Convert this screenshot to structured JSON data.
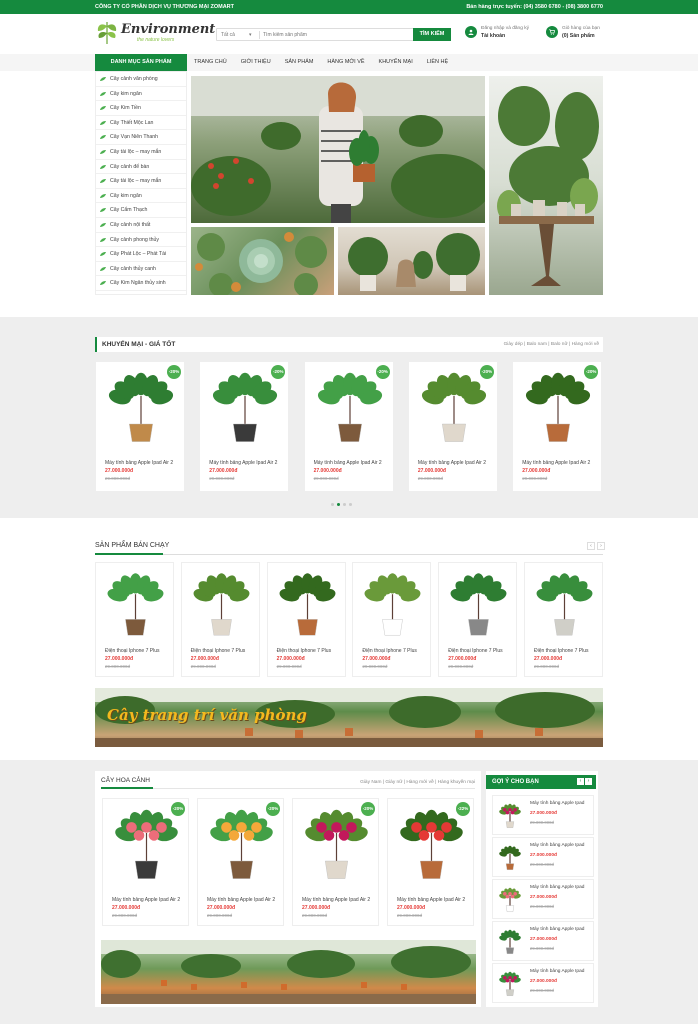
{
  "topbar": {
    "company": "CÔNG TY CỔ PHẦN DỊCH VỤ THƯƠNG MẠI ZOMART",
    "hotline": "Bán hàng trực tuyến: (04) 3580 6780 - (08) 3800 6770"
  },
  "header": {
    "logo_text": "Environment",
    "logo_tagline": "the nature lovers",
    "search_category": "Tất cả",
    "search_placeholder": "Tìm kiếm sản phẩm",
    "search_button": "TÌM KIẾM",
    "account_line1": "Đăng nhập và đăng ký",
    "account_line2": "Tài khoản",
    "cart_line1": "Giỏ hàng của bạn",
    "cart_line2": "(0) Sản phẩm"
  },
  "nav": {
    "category_heading": "DANH MỤC SẢN PHẨM",
    "menu": [
      "TRANG CHỦ",
      "GIỚI THIỆU",
      "SẢN PHẨM",
      "HÀNG MỚI VỀ",
      "KHUYẾN MẠI",
      "LIÊN HỆ"
    ]
  },
  "sidebar": {
    "items": [
      "Cây cảnh văn phòng",
      "Cây kim ngân",
      "Cây Kim Tiền",
      "Cây Thiết Mộc Lan",
      "Cây Vạn Niên Thanh",
      "Cây tài lộc – may mắn",
      "Cây cảnh để bàn",
      "Cây tài lộc – may mắn",
      "Cây kim ngân",
      "Cây Cẩm Thạch",
      "Cây cảnh nội thất",
      "Cây cảnh phong thủy",
      "Cây Phát Lộc – Phát Tài",
      "Cây cảnh thủy canh",
      "Cây Kim Ngân thủy sinh"
    ]
  },
  "promo": {
    "title": "KHUYẾN MẠI - GIÁ TỐT",
    "links": "Giày dép  |  Balo nam  |  Balo nữ  |  Hàng mới về",
    "products": [
      {
        "name": "Máy tính bảng Apple Ipad Air 2",
        "price": "27.000.000đ",
        "old": "29.000.000đ",
        "badge": "-20%"
      },
      {
        "name": "Máy tính bảng Apple Ipad Air 2",
        "price": "27.000.000đ",
        "old": "29.000.000đ",
        "badge": "-20%"
      },
      {
        "name": "Máy tính bảng Apple Ipad Air 2",
        "price": "27.000.000đ",
        "old": "29.000.000đ",
        "badge": "-20%"
      },
      {
        "name": "Máy tính bảng Apple Ipad Air 2",
        "price": "27.000.000đ",
        "old": "29.000.000đ",
        "badge": "-20%"
      },
      {
        "name": "Máy tính bảng Apple Ipad Air 2",
        "price": "27.000.000đ",
        "old": "29.000.000đ",
        "badge": "-20%"
      }
    ]
  },
  "bestseller": {
    "title": "SẢN PHẨM BÁN CHẠY",
    "products": [
      {
        "name": "Điện thoại Iphone 7 Plus",
        "price": "27.000.000đ",
        "old": "29.000.000đ"
      },
      {
        "name": "Điện thoại Iphone 7 Plus",
        "price": "27.000.000đ",
        "old": "29.000.000đ"
      },
      {
        "name": "Điện thoại Iphone 7 Plus",
        "price": "27.000.000đ",
        "old": "29.000.000đ"
      },
      {
        "name": "Điện thoại Iphone 7 Plus",
        "price": "27.000.000đ",
        "old": "29.000.000đ"
      },
      {
        "name": "Điện thoại Iphone 7 Plus",
        "price": "27.000.000đ",
        "old": "29.000.000đ"
      },
      {
        "name": "Điện thoại Iphone 7 Plus",
        "price": "27.000.000đ",
        "old": "29.000.000đ"
      }
    ]
  },
  "banner": {
    "text": "Cây trang trí văn phòng"
  },
  "flowers": {
    "title": "CÂY HOA CẢNH",
    "links": "Giày Nam  |  Giày nữ  |  Hàng mới về  |  Hàng khuyến mại",
    "products": [
      {
        "name": "Máy tính bảng Apple Ipad Air 2",
        "price": "27.000.000đ",
        "old": "29.000.000đ",
        "badge": "-20%"
      },
      {
        "name": "Máy tính bảng Apple Ipad Air 2",
        "price": "27.000.000đ",
        "old": "29.000.000đ",
        "badge": "-20%"
      },
      {
        "name": "Máy tính bảng Apple Ipad Air 2",
        "price": "27.000.000đ",
        "old": "29.000.000đ",
        "badge": "-20%"
      },
      {
        "name": "Máy tính bảng Apple Ipad Air 2",
        "price": "27.000.000đ",
        "old": "29.000.000đ",
        "badge": "-22%"
      }
    ]
  },
  "suggest": {
    "title": "GỢI Ý CHO BẠN",
    "items": [
      {
        "name": "Máy tính bảng Apple Ipad",
        "price": "27.000.000đ",
        "old": "29.000.000đ"
      },
      {
        "name": "Máy tính bảng Apple Ipad",
        "price": "27.000.000đ",
        "old": "29.000.000đ"
      },
      {
        "name": "Máy tính bảng Apple Ipad",
        "price": "27.000.000đ",
        "old": "29.000.000đ"
      },
      {
        "name": "Máy tính bảng Apple Ipad",
        "price": "27.000.000đ",
        "old": "29.000.000đ"
      },
      {
        "name": "Máy tính bảng Apple Ipad",
        "price": "27.000.000đ",
        "old": "29.000.000đ"
      }
    ]
  },
  "colors": {
    "brand": "#158a3e",
    "sale_badge": "#4caf50",
    "price": "#e53935"
  }
}
